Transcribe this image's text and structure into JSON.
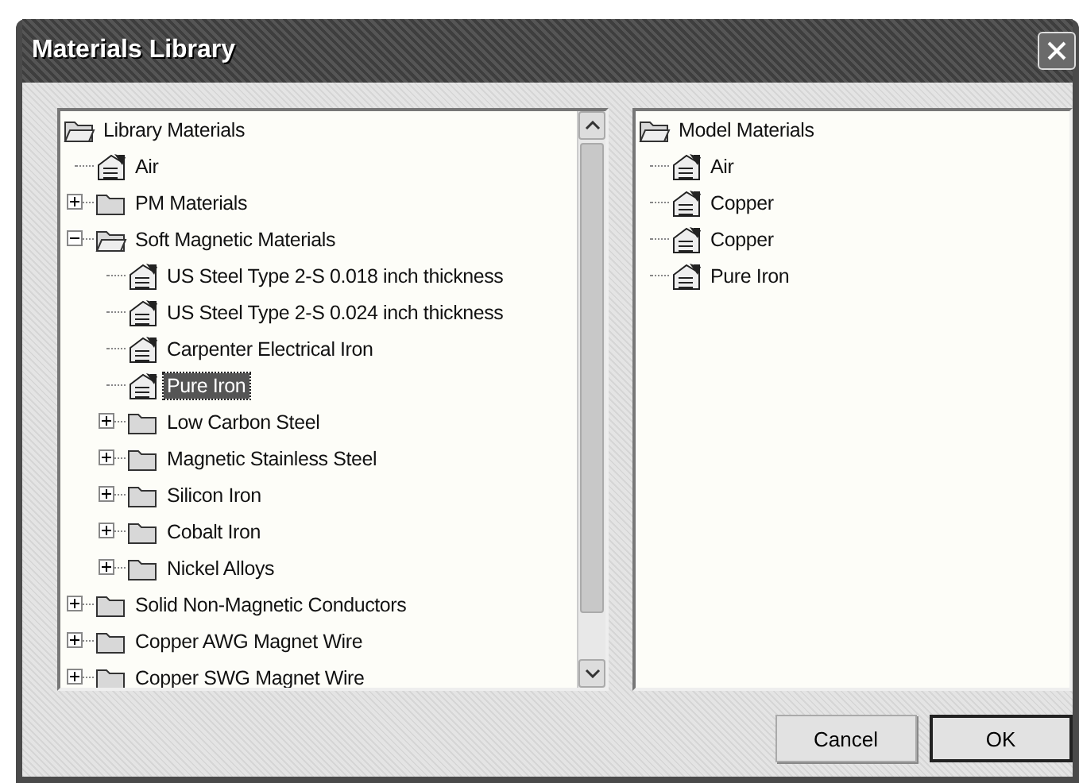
{
  "window": {
    "title": "Materials Library"
  },
  "library_tree": {
    "label": "Library Materials",
    "children": [
      {
        "label": "Air",
        "kind": "material",
        "selected": false
      },
      {
        "label": "PM Materials",
        "kind": "folder",
        "expanded": false,
        "selected": false
      },
      {
        "label": "Soft Magnetic Materials",
        "kind": "folder",
        "expanded": true,
        "selected": false,
        "children": [
          {
            "label": "US Steel Type 2-S 0.018 inch thickness",
            "kind": "material",
            "selected": false
          },
          {
            "label": "US Steel Type 2-S 0.024 inch thickness",
            "kind": "material",
            "selected": false
          },
          {
            "label": "Carpenter Electrical Iron",
            "kind": "material",
            "selected": false
          },
          {
            "label": "Pure Iron",
            "kind": "material",
            "selected": true
          },
          {
            "label": "Low Carbon Steel",
            "kind": "folder",
            "expanded": false,
            "selected": false
          },
          {
            "label": "Magnetic Stainless Steel",
            "kind": "folder",
            "expanded": false,
            "selected": false
          },
          {
            "label": "Silicon Iron",
            "kind": "folder",
            "expanded": false,
            "selected": false
          },
          {
            "label": "Cobalt Iron",
            "kind": "folder",
            "expanded": false,
            "selected": false
          },
          {
            "label": "Nickel Alloys",
            "kind": "folder",
            "expanded": false,
            "selected": false
          }
        ]
      },
      {
        "label": "Solid Non-Magnetic Conductors",
        "kind": "folder",
        "expanded": false,
        "selected": false
      },
      {
        "label": "Copper AWG Magnet Wire",
        "kind": "folder",
        "expanded": false,
        "selected": false
      },
      {
        "label": "Copper SWG Magnet Wire",
        "kind": "folder",
        "expanded": false,
        "selected": false
      }
    ]
  },
  "model_tree": {
    "label": "Model Materials",
    "children": [
      {
        "label": "Air",
        "kind": "material",
        "selected": false
      },
      {
        "label": "Copper",
        "kind": "material",
        "selected": false
      },
      {
        "label": "Copper",
        "kind": "material",
        "selected": false
      },
      {
        "label": "Pure Iron",
        "kind": "material",
        "selected": false
      }
    ]
  },
  "buttons": [
    {
      "label": "Cancel",
      "default": false
    },
    {
      "label": "OK",
      "default": true
    }
  ]
}
